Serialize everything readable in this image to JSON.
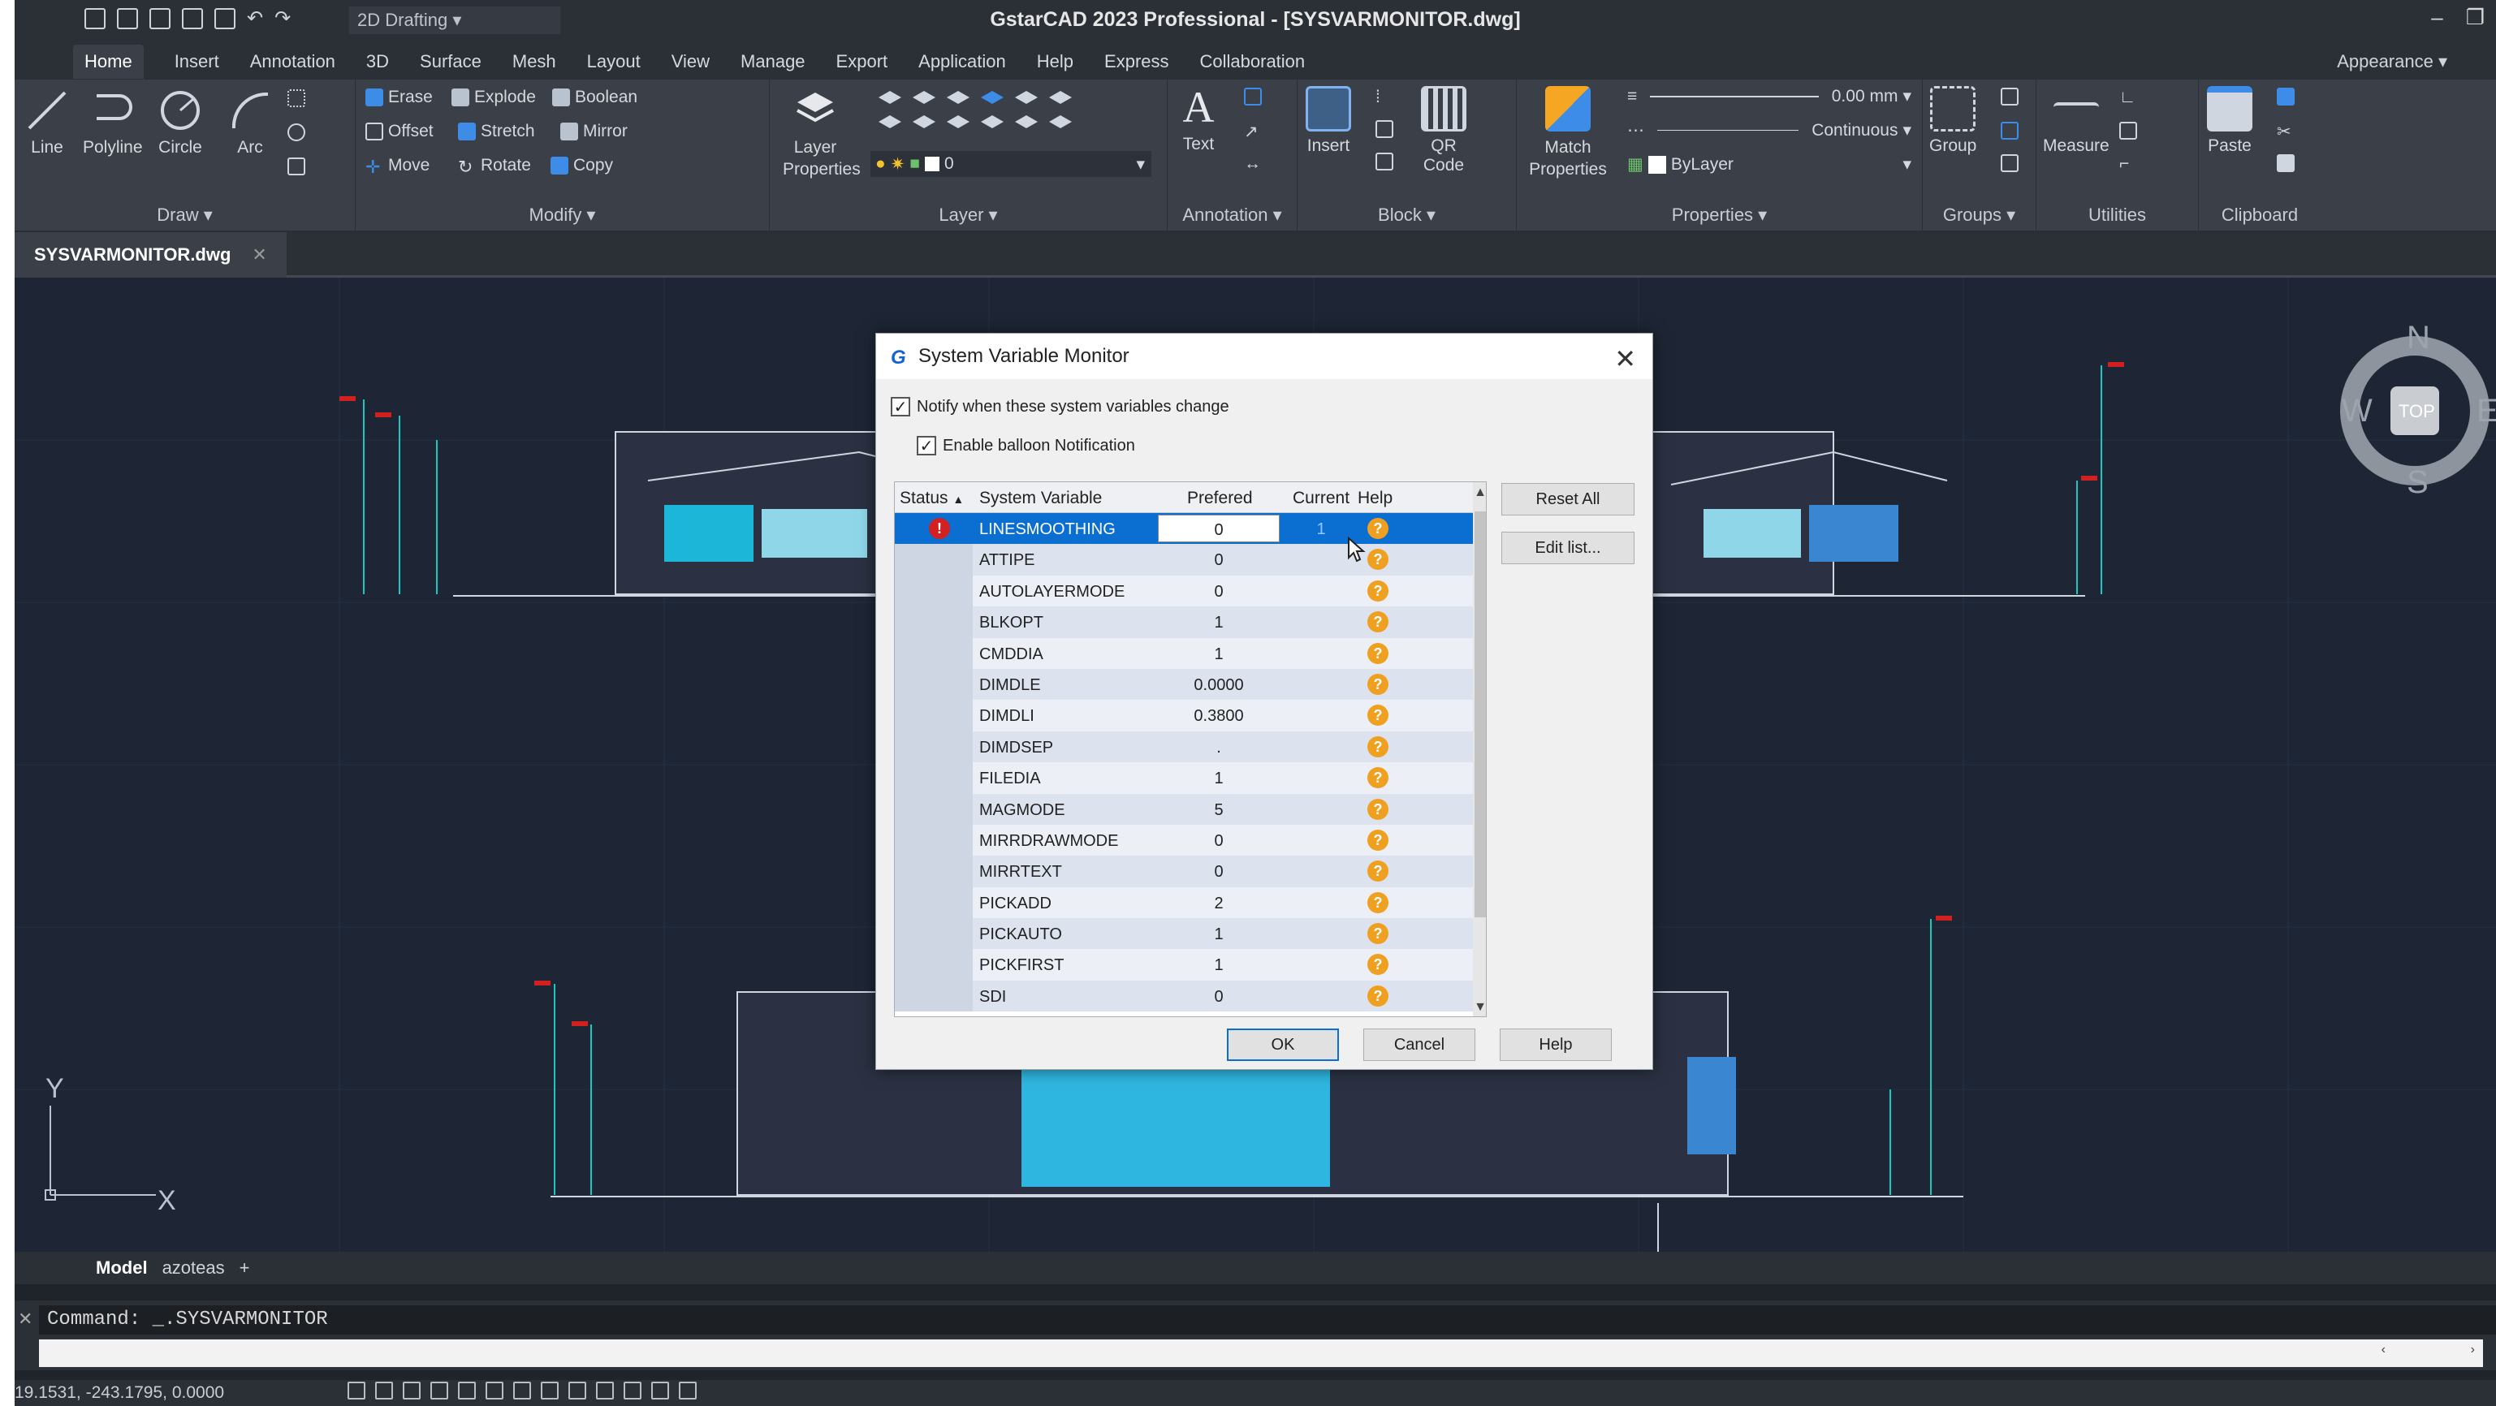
{
  "app": {
    "title": "GstarCAD 2023 Professional - [SYSVARMONITOR.dwg]",
    "logo": "G",
    "workspace": "2D Drafting",
    "appearance": "Appearance"
  },
  "menu": [
    "Home",
    "Insert",
    "Annotation",
    "3D",
    "Surface",
    "Mesh",
    "Layout",
    "View",
    "Manage",
    "Export",
    "Application",
    "Help",
    "Express",
    "Collaboration"
  ],
  "ribbon": {
    "draw": {
      "label": "Draw",
      "line": "Line",
      "polyline": "Polyline",
      "circle": "Circle",
      "arc": "Arc"
    },
    "modify": {
      "label": "Modify",
      "erase": "Erase",
      "explode": "Explode",
      "boolean": "Boolean",
      "offset": "Offset",
      "stretch": "Stretch",
      "mirror": "Mirror",
      "move": "Move",
      "rotate": "Rotate",
      "copy": "Copy"
    },
    "layer": {
      "label": "Layer",
      "layer_properties": "Layer Properties",
      "current_layer": "0"
    },
    "annotation": {
      "label": "Annotation",
      "text": "Text"
    },
    "block": {
      "label": "Block",
      "insert": "Insert",
      "qr_code": "QR Code"
    },
    "properties": {
      "label": "Properties",
      "match": "Match Properties",
      "lineweight": "0.00 mm",
      "linetype": "Continuous",
      "color": "ByLayer"
    },
    "groups": {
      "label": "Groups",
      "group": "Group"
    },
    "utilities": {
      "label": "Utilities",
      "measure": "Measure"
    },
    "clipboard": {
      "label": "Clipboard",
      "paste": "Paste"
    }
  },
  "doc_tab": "SYSVARMONITOR.dwg",
  "viewcube": {
    "n": "N",
    "s": "S",
    "e": "E",
    "w": "W",
    "top": "TOP"
  },
  "ucs": {
    "x": "X",
    "y": "Y"
  },
  "layout_tabs": [
    "Model",
    "azoteas",
    "+"
  ],
  "command": {
    "text": "Command:  _.SYSVARMONITOR"
  },
  "status": {
    "coords": "19.1531, -243.1795, 0.0000"
  },
  "dialog": {
    "title": "System Variable Monitor",
    "notify_label": "Notify when these system variables change",
    "notify_checked": true,
    "balloon_label": "Enable balloon Notification",
    "balloon_checked": true,
    "columns": {
      "status": "Status",
      "variable": "System Variable",
      "preferred": "Prefered",
      "current": "Current",
      "help": "Help"
    },
    "rows": [
      {
        "name": "LINESMOOTHING",
        "preferred": "0",
        "current": "1",
        "warning": true
      },
      {
        "name": "ATTIPE",
        "preferred": "0",
        "current": ""
      },
      {
        "name": "AUTOLAYERMODE",
        "preferred": "0",
        "current": ""
      },
      {
        "name": "BLKOPT",
        "preferred": "1",
        "current": ""
      },
      {
        "name": "CMDDIA",
        "preferred": "1",
        "current": ""
      },
      {
        "name": "DIMDLE",
        "preferred": "0.0000",
        "current": ""
      },
      {
        "name": "DIMDLI",
        "preferred": "0.3800",
        "current": ""
      },
      {
        "name": "DIMDSEP",
        "preferred": ".",
        "current": ""
      },
      {
        "name": "FILEDIA",
        "preferred": "1",
        "current": ""
      },
      {
        "name": "MAGMODE",
        "preferred": "5",
        "current": ""
      },
      {
        "name": "MIRRDRAWMODE",
        "preferred": "0",
        "current": ""
      },
      {
        "name": "MIRRTEXT",
        "preferred": "0",
        "current": ""
      },
      {
        "name": "PICKADD",
        "preferred": "2",
        "current": ""
      },
      {
        "name": "PICKAUTO",
        "preferred": "1",
        "current": ""
      },
      {
        "name": "PICKFIRST",
        "preferred": "1",
        "current": ""
      },
      {
        "name": "SDI",
        "preferred": "0",
        "current": ""
      }
    ],
    "help_glyph": "?",
    "warn_glyph": "!",
    "reset_all": "Reset All",
    "edit_list": "Edit list...",
    "ok": "OK",
    "cancel": "Cancel",
    "help": "Help"
  }
}
